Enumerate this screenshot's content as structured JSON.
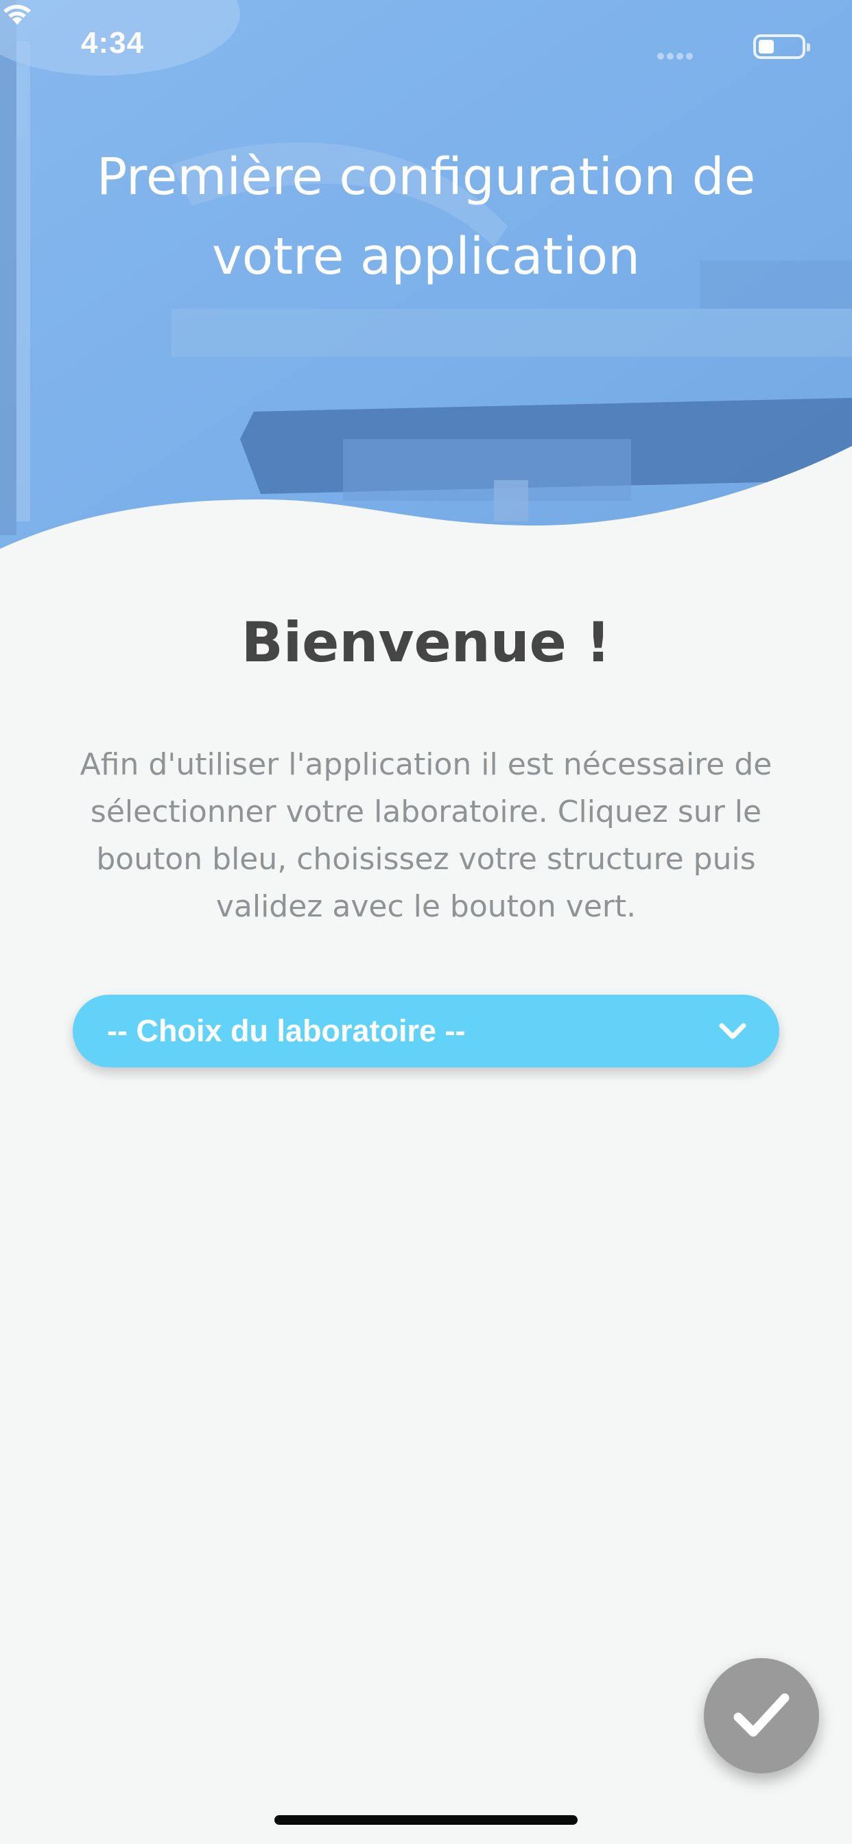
{
  "status_bar": {
    "time": "4:34"
  },
  "header": {
    "title": "Première configuration de votre application"
  },
  "main": {
    "heading": "Bienvenue !",
    "intro": "Afin d'utiliser l'application il est nécessaire de sélectionner votre laboratoire. Cliquez sur le bouton bleu, choisissez votre structure puis validez avec le bouton vert.",
    "lab_select": {
      "label": "-- Choix du laboratoire --",
      "icon": "chevron-down-icon"
    }
  },
  "validate_button": {
    "icon": "check-icon"
  },
  "colors": {
    "hero_blue": "#7fb2ea",
    "select_blue": "#63d2f8",
    "fab_grey": "#9a9a9a",
    "background": "#f5f6f6",
    "heading": "#454545",
    "body_text": "#8e9396"
  }
}
